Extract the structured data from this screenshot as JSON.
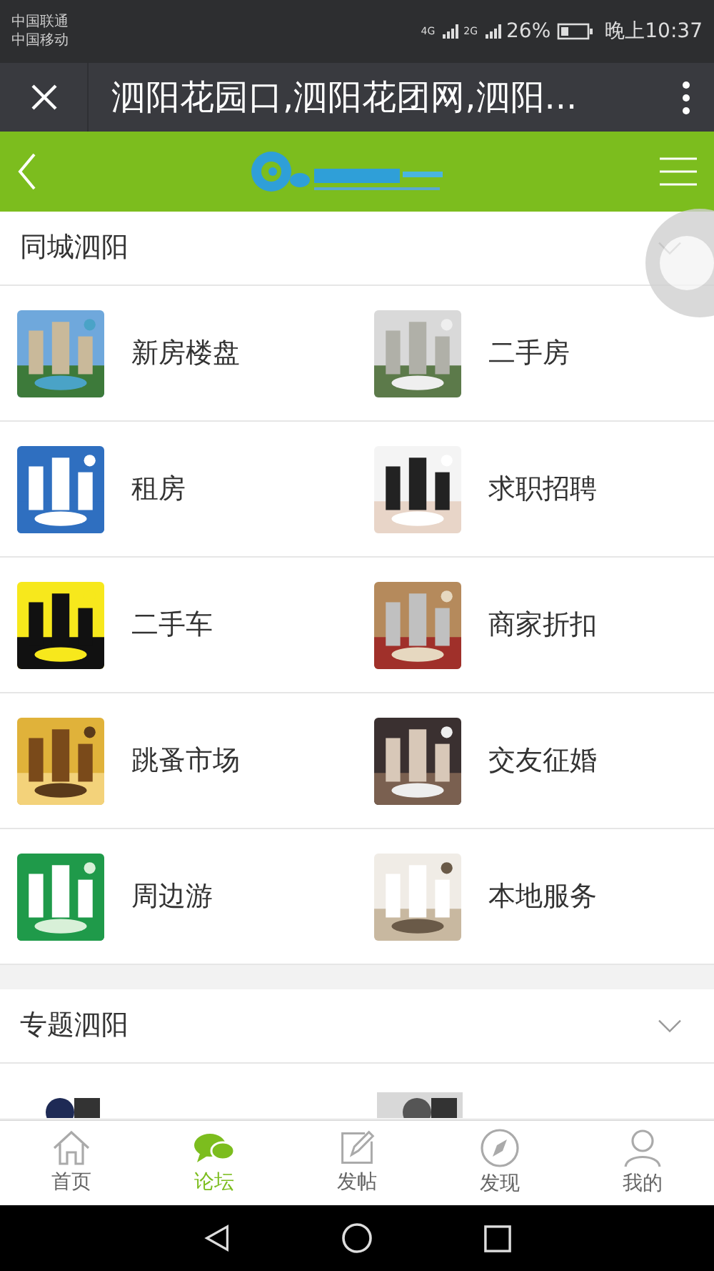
{
  "status_bar": {
    "carriers": [
      "中国联通",
      "中国移动"
    ],
    "network_1": "4G",
    "network_2": "2G",
    "battery": "26%",
    "time": "晚上10:37"
  },
  "title_bar": {
    "title": "泗阳花园口,泗阳花团网,泗阳..."
  },
  "sections": [
    {
      "title": "同城泗阳",
      "items": [
        {
          "label": "新房楼盘"
        },
        {
          "label": "二手房"
        },
        {
          "label": "租房"
        },
        {
          "label": "求职招聘"
        },
        {
          "label": "二手车"
        },
        {
          "label": "商家折扣"
        },
        {
          "label": "跳蚤市场"
        },
        {
          "label": "交友征婚"
        },
        {
          "label": "周边游"
        },
        {
          "label": "本地服务"
        }
      ]
    },
    {
      "title": "专题泗阳"
    }
  ],
  "tabs": [
    {
      "label": "首页",
      "selected": false
    },
    {
      "label": "论坛",
      "selected": true
    },
    {
      "label": "发帖",
      "selected": false
    },
    {
      "label": "发现",
      "selected": false
    },
    {
      "label": "我的",
      "selected": false
    }
  ]
}
